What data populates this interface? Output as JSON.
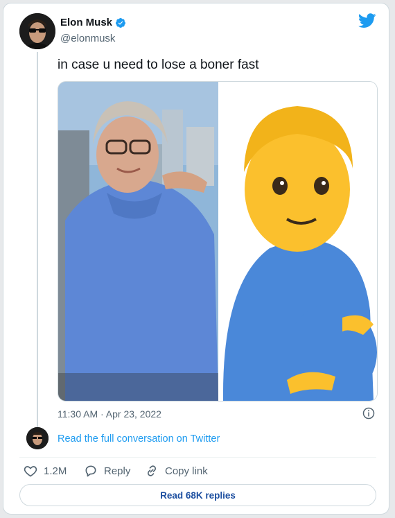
{
  "author": {
    "name": "Elon Musk",
    "handle": "@elonmusk",
    "verified": true
  },
  "tweet": {
    "text": "in case u need to lose a boner fast",
    "timestamp": "11:30 AM · Apr 23, 2022"
  },
  "conversation_link": "Read the full conversation on Twitter",
  "actions": {
    "likes": "1.2M",
    "reply": "Reply",
    "copy_link": "Copy link"
  },
  "read_replies": "Read 68K replies",
  "colors": {
    "accent": "#1d9bf0",
    "text": "#0f1419",
    "muted": "#536471",
    "like": "#536471"
  },
  "icons": [
    "twitter-bird-icon",
    "verified-icon",
    "info-icon",
    "heart-icon",
    "reply-icon",
    "link-icon"
  ]
}
